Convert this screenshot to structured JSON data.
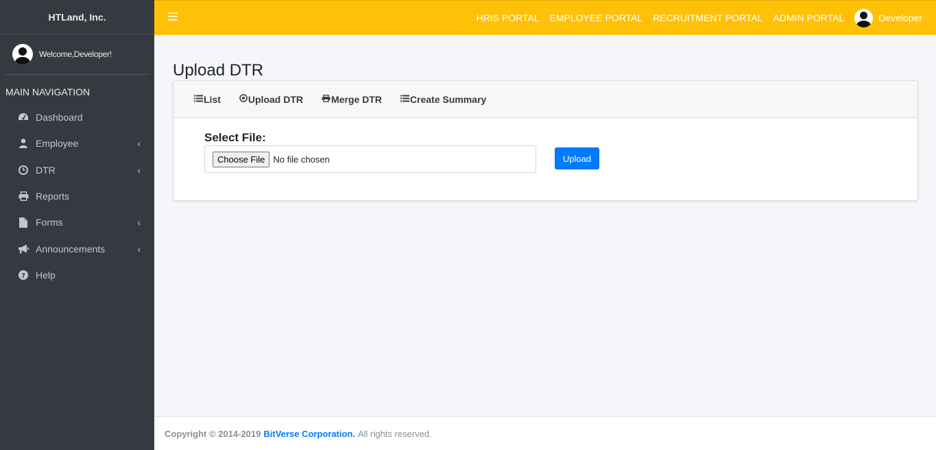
{
  "brand": "HTLand, Inc.",
  "user_panel": {
    "welcome": "Welcome,Developer!"
  },
  "sidebar": {
    "header": "MAIN NAVIGATION",
    "items": [
      {
        "label": "Dashboard",
        "icon": "dashboard-icon",
        "has_children": false
      },
      {
        "label": "Employee",
        "icon": "user-icon",
        "has_children": true
      },
      {
        "label": "DTR",
        "icon": "clock-icon",
        "has_children": true
      },
      {
        "label": "Reports",
        "icon": "printer-icon",
        "has_children": false
      },
      {
        "label": "Forms",
        "icon": "file-icon",
        "has_children": true
      },
      {
        "label": "Announcements",
        "icon": "megaphone-icon",
        "has_children": true
      },
      {
        "label": "Help",
        "icon": "help-icon",
        "has_children": false
      }
    ]
  },
  "topbar": {
    "links": [
      "HRIS PORTAL",
      "EMPLOYEE PORTAL",
      "RECRUITMENT PORTAL",
      "ADMIN PORTAL"
    ],
    "user": "Developer",
    "color": "#ffc107"
  },
  "page": {
    "title": "Upload DTR",
    "tabs": [
      {
        "label": "List",
        "icon": "list-icon"
      },
      {
        "label": "Upload DTR",
        "icon": "upload-circle-icon"
      },
      {
        "label": "Merge DTR",
        "icon": "printer-icon"
      },
      {
        "label": "Create Summary",
        "icon": "list-icon"
      }
    ],
    "form": {
      "label": "Select File:",
      "choose_button": "Choose File",
      "file_status": "No file chosen",
      "upload_button": "Upload"
    }
  },
  "footer": {
    "copyright": "Copyright © 2014-2019",
    "company": "BitVerse Corporation.",
    "rights": "All rights reserved."
  }
}
